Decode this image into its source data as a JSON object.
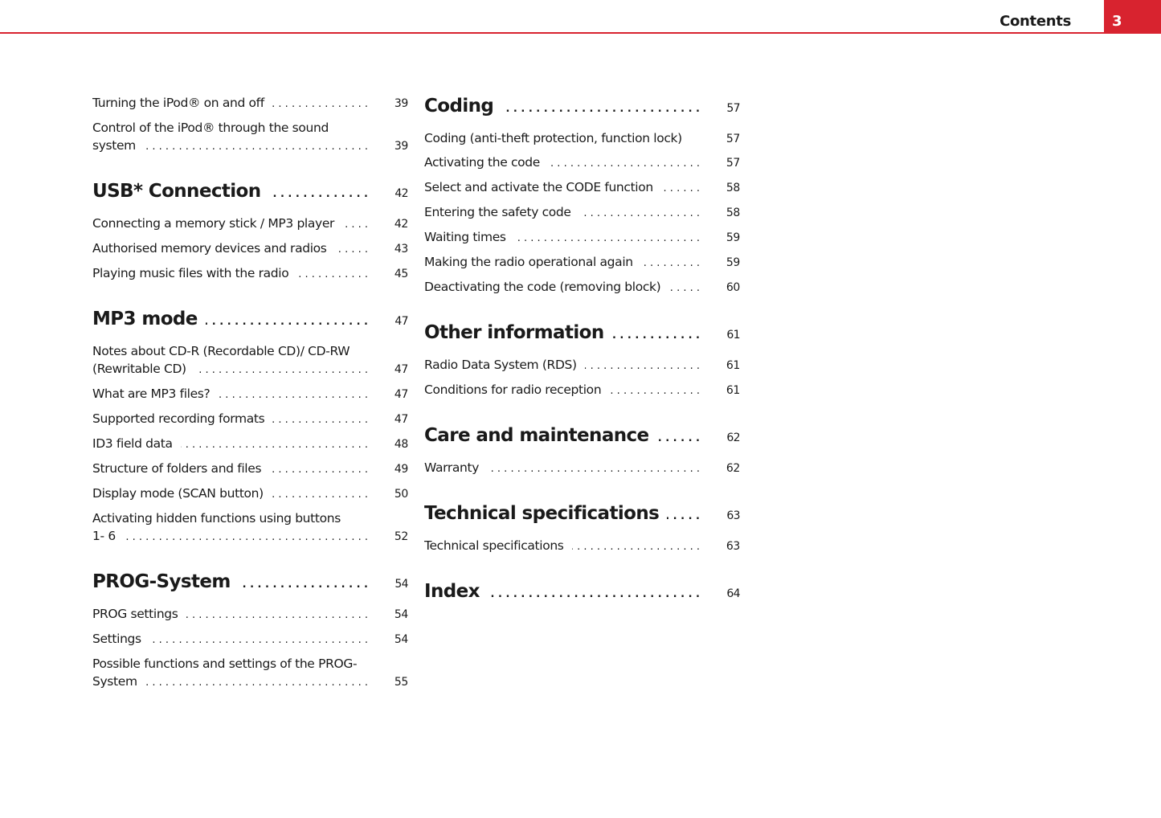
{
  "header": {
    "title": "Contents",
    "page_number": "3",
    "accent_color": "#d8232f"
  },
  "left_column": [
    {
      "type": "entry",
      "lines": [
        "Turning the iPod® on and off"
      ],
      "page": "39"
    },
    {
      "type": "entry",
      "lines": [
        "Control of the iPod® through the sound",
        "system"
      ],
      "page": "39"
    },
    {
      "type": "heading",
      "title": "USB* Connection",
      "page": "42"
    },
    {
      "type": "entry",
      "lines": [
        "Connecting a memory stick / MP3 player"
      ],
      "page": "42"
    },
    {
      "type": "entry",
      "lines": [
        "Authorised memory devices and radios"
      ],
      "page": "43"
    },
    {
      "type": "entry",
      "lines": [
        "Playing music files with the radio"
      ],
      "page": "45"
    },
    {
      "type": "heading",
      "title": "MP3 mode",
      "page": "47"
    },
    {
      "type": "entry",
      "lines": [
        "Notes about CD-R (Recordable CD)/ CD-RW",
        "(Rewritable CD)"
      ],
      "page": "47"
    },
    {
      "type": "entry",
      "lines": [
        "What are MP3 files?"
      ],
      "page": "47"
    },
    {
      "type": "entry",
      "lines": [
        "Supported recording formats"
      ],
      "page": "47"
    },
    {
      "type": "entry",
      "lines": [
        "ID3 field data"
      ],
      "page": "48"
    },
    {
      "type": "entry",
      "lines": [
        "Structure of folders and files"
      ],
      "page": "49"
    },
    {
      "type": "entry",
      "lines": [
        "Display mode (SCAN button)"
      ],
      "page": "50"
    },
    {
      "type": "entry",
      "lines": [
        "Activating hidden functions using buttons",
        "1- 6"
      ],
      "page": "52"
    },
    {
      "type": "heading",
      "title": "PROG-System",
      "page": "54"
    },
    {
      "type": "entry",
      "lines": [
        "PROG settings"
      ],
      "page": "54"
    },
    {
      "type": "entry",
      "lines": [
        "Settings"
      ],
      "page": "54"
    },
    {
      "type": "entry",
      "lines": [
        "Possible functions and settings of the PROG-",
        "System"
      ],
      "page": "55"
    }
  ],
  "right_column": [
    {
      "type": "heading",
      "title": "Coding",
      "page": "57",
      "first": true
    },
    {
      "type": "entry",
      "lines": [
        "Coding (anti-theft protection, function lock)"
      ],
      "page": "57",
      "nodots": true
    },
    {
      "type": "entry",
      "lines": [
        "Activating the code"
      ],
      "page": "57"
    },
    {
      "type": "entry",
      "lines": [
        "Select and activate the CODE function"
      ],
      "page": "58"
    },
    {
      "type": "entry",
      "lines": [
        "Entering the safety code"
      ],
      "page": "58"
    },
    {
      "type": "entry",
      "lines": [
        "Waiting times"
      ],
      "page": "59"
    },
    {
      "type": "entry",
      "lines": [
        "Making the radio operational again"
      ],
      "page": "59"
    },
    {
      "type": "entry",
      "lines": [
        "Deactivating the code (removing block)"
      ],
      "page": "60"
    },
    {
      "type": "heading",
      "title": "Other information",
      "page": "61"
    },
    {
      "type": "entry",
      "lines": [
        "Radio Data System (RDS)"
      ],
      "page": "61"
    },
    {
      "type": "entry",
      "lines": [
        "Conditions for radio reception"
      ],
      "page": "61"
    },
    {
      "type": "heading",
      "title": "Care and maintenance",
      "page": "62"
    },
    {
      "type": "entry",
      "lines": [
        "Warranty"
      ],
      "page": "62"
    },
    {
      "type": "heading",
      "title": "Technical specifications",
      "page": "63"
    },
    {
      "type": "entry",
      "lines": [
        "Technical specifications"
      ],
      "page": "63"
    },
    {
      "type": "heading",
      "title": "Index",
      "page": "64"
    }
  ]
}
